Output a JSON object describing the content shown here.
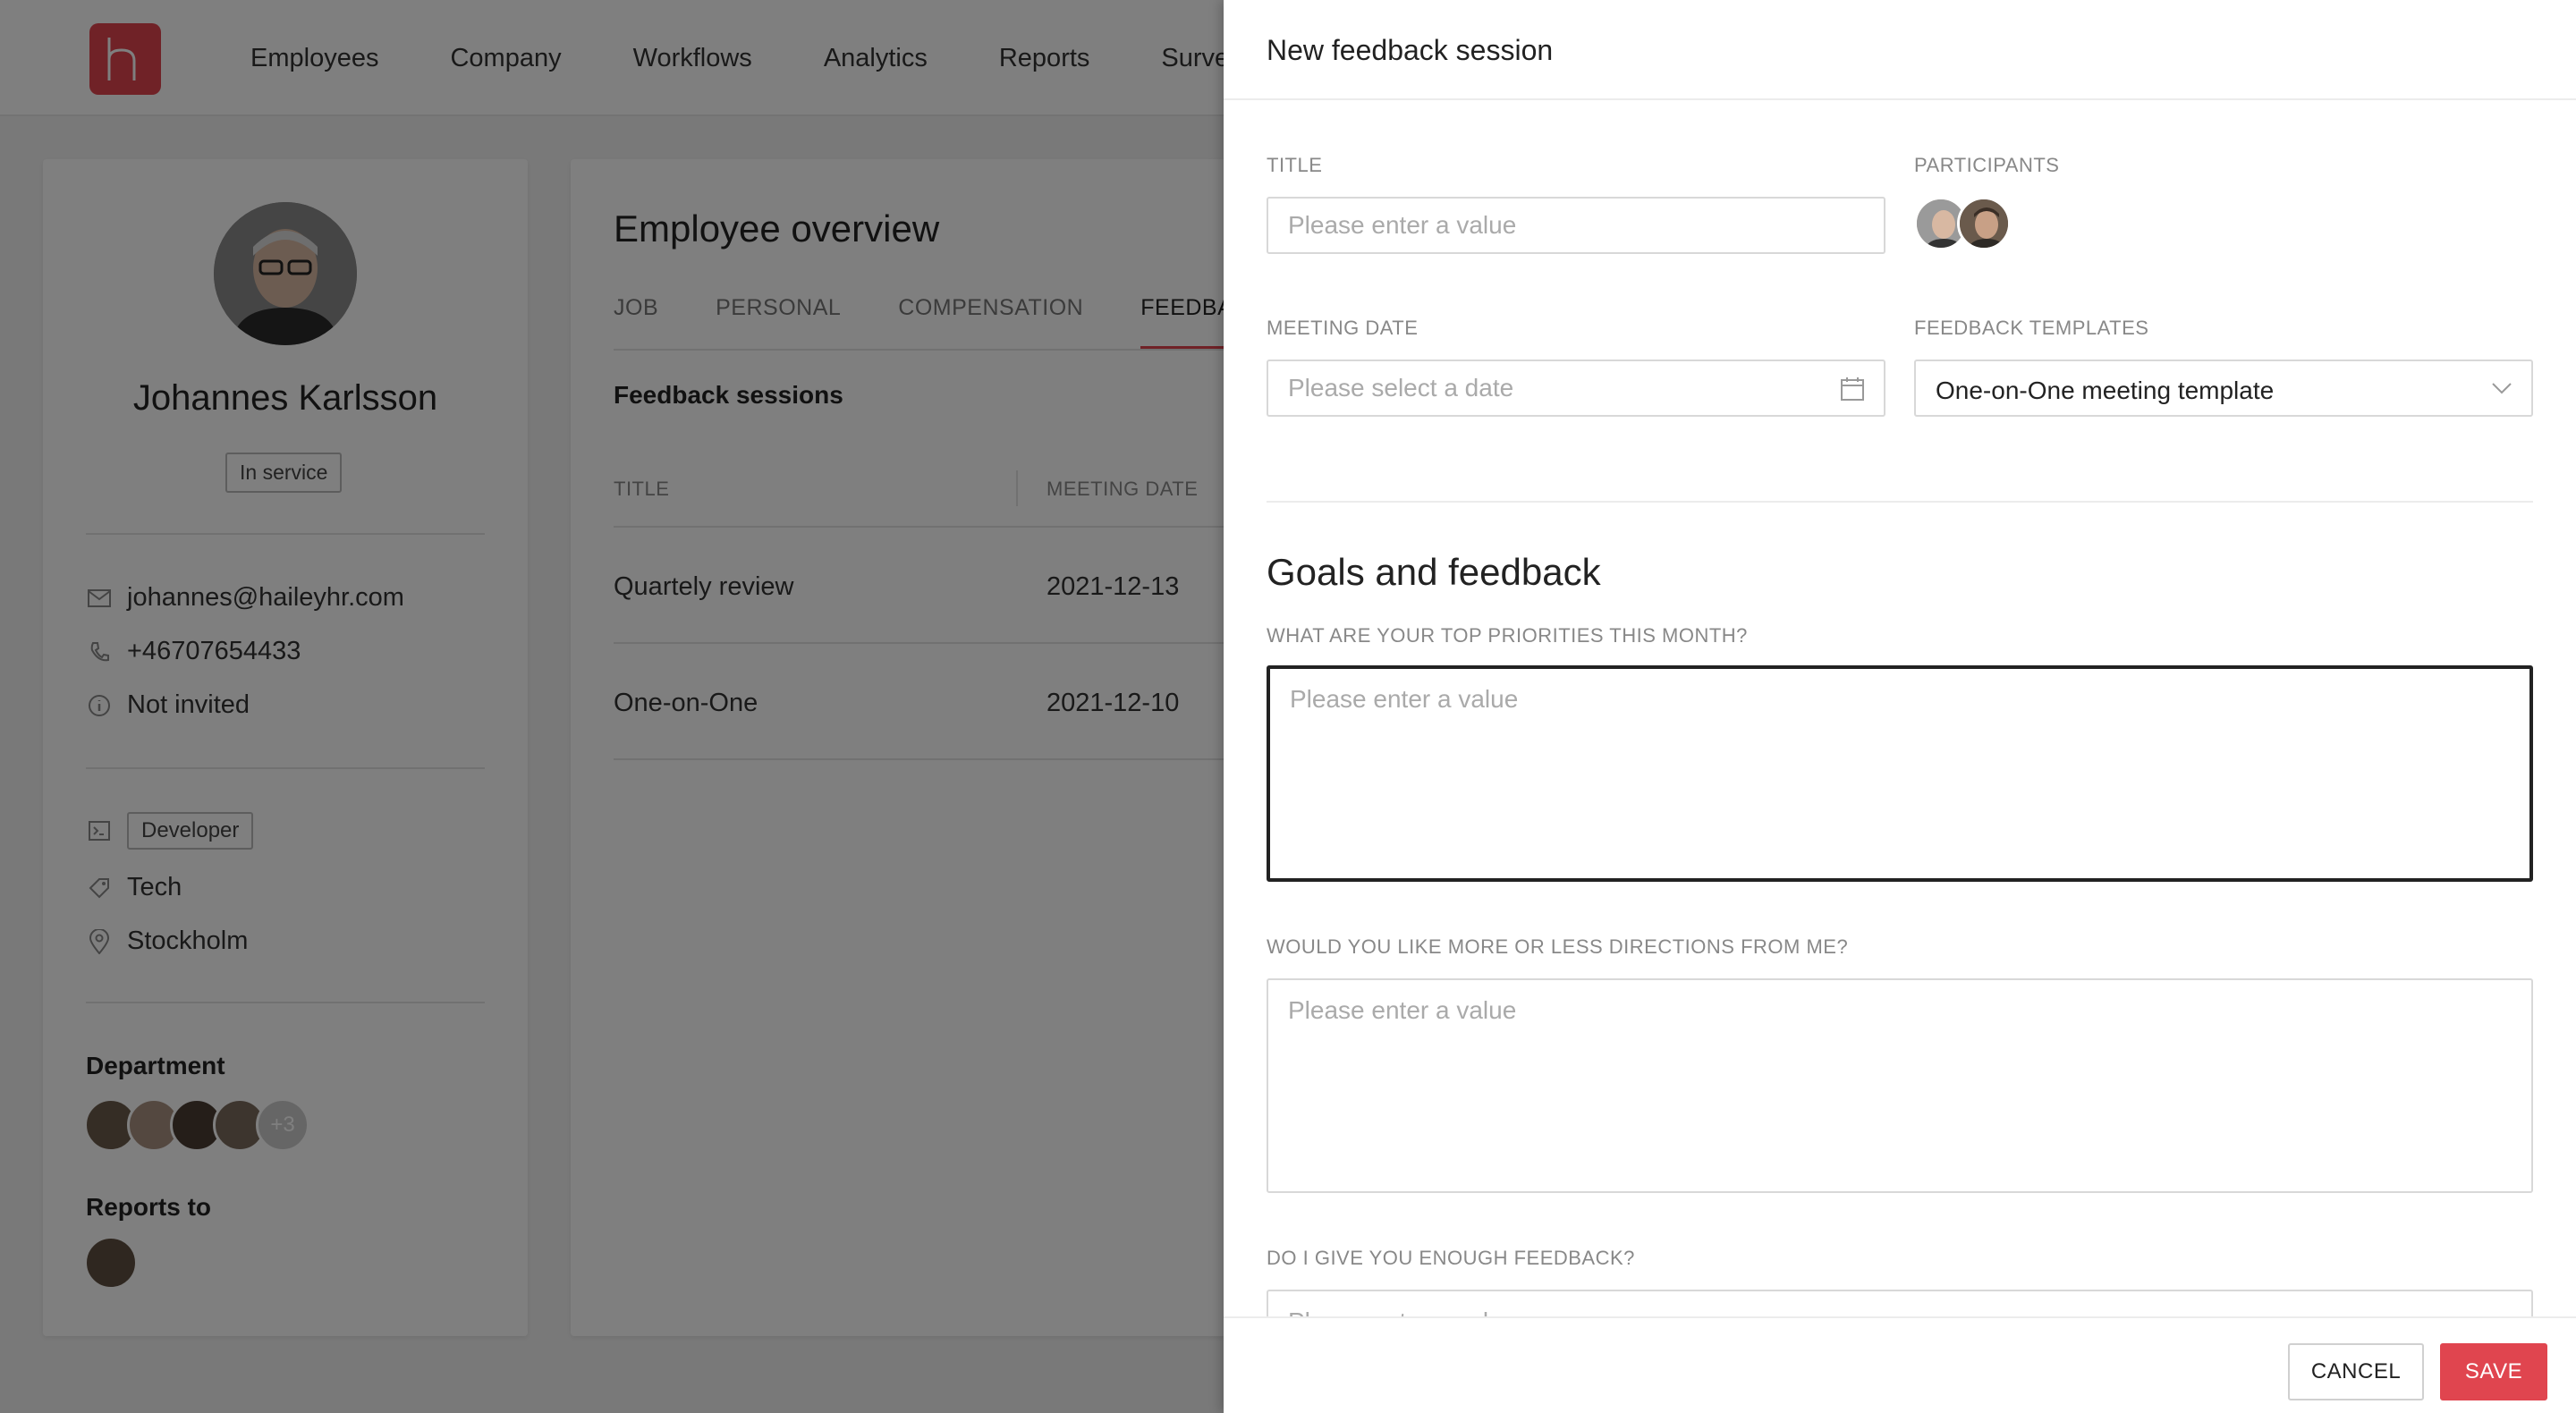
{
  "app": {
    "nav": [
      "Employees",
      "Company",
      "Workflows",
      "Analytics",
      "Reports",
      "Surveys"
    ]
  },
  "profile": {
    "name": "Johannes Karlsson",
    "status": "In service",
    "email": "johannes@haileyhr.com",
    "phone": "+46707654433",
    "invite_status": "Not invited",
    "role": "Developer",
    "team": "Tech",
    "location": "Stockholm",
    "department_label": "Department",
    "department_more": "+3",
    "reports_to_label": "Reports to"
  },
  "overview": {
    "title": "Employee overview",
    "tabs": [
      "JOB",
      "PERSONAL",
      "COMPENSATION",
      "FEEDBACK"
    ],
    "active_tab": "FEEDBACK",
    "section_title": "Feedback sessions",
    "columns": [
      "TITLE",
      "MEETING DATE"
    ],
    "rows": [
      {
        "title": "Quartely review",
        "date": "2021-12-13"
      },
      {
        "title": "One-on-One",
        "date": "2021-12-10"
      }
    ]
  },
  "drawer": {
    "title": "New feedback session",
    "title_label": "TITLE",
    "title_placeholder": "Please enter a value",
    "participants_label": "PARTICIPANTS",
    "meeting_date_label": "MEETING DATE",
    "meeting_date_placeholder": "Please select a date",
    "templates_label": "FEEDBACK TEMPLATES",
    "template_value": "One-on-One meeting template",
    "goals_title": "Goals and feedback",
    "questions": [
      {
        "label": "WHAT ARE YOUR TOP PRIORITIES THIS MONTH?",
        "placeholder": "Please enter a value"
      },
      {
        "label": "WOULD YOU LIKE MORE OR LESS DIRECTIONS FROM ME?",
        "placeholder": "Please enter a value"
      },
      {
        "label": "DO I GIVE YOU ENOUGH FEEDBACK?",
        "placeholder": "Please enter a value"
      }
    ],
    "cancel_label": "CANCEL",
    "save_label": "SAVE"
  },
  "colors": {
    "brand": "#e0454f",
    "overlay": "rgba(0,0,0,0.5)"
  }
}
